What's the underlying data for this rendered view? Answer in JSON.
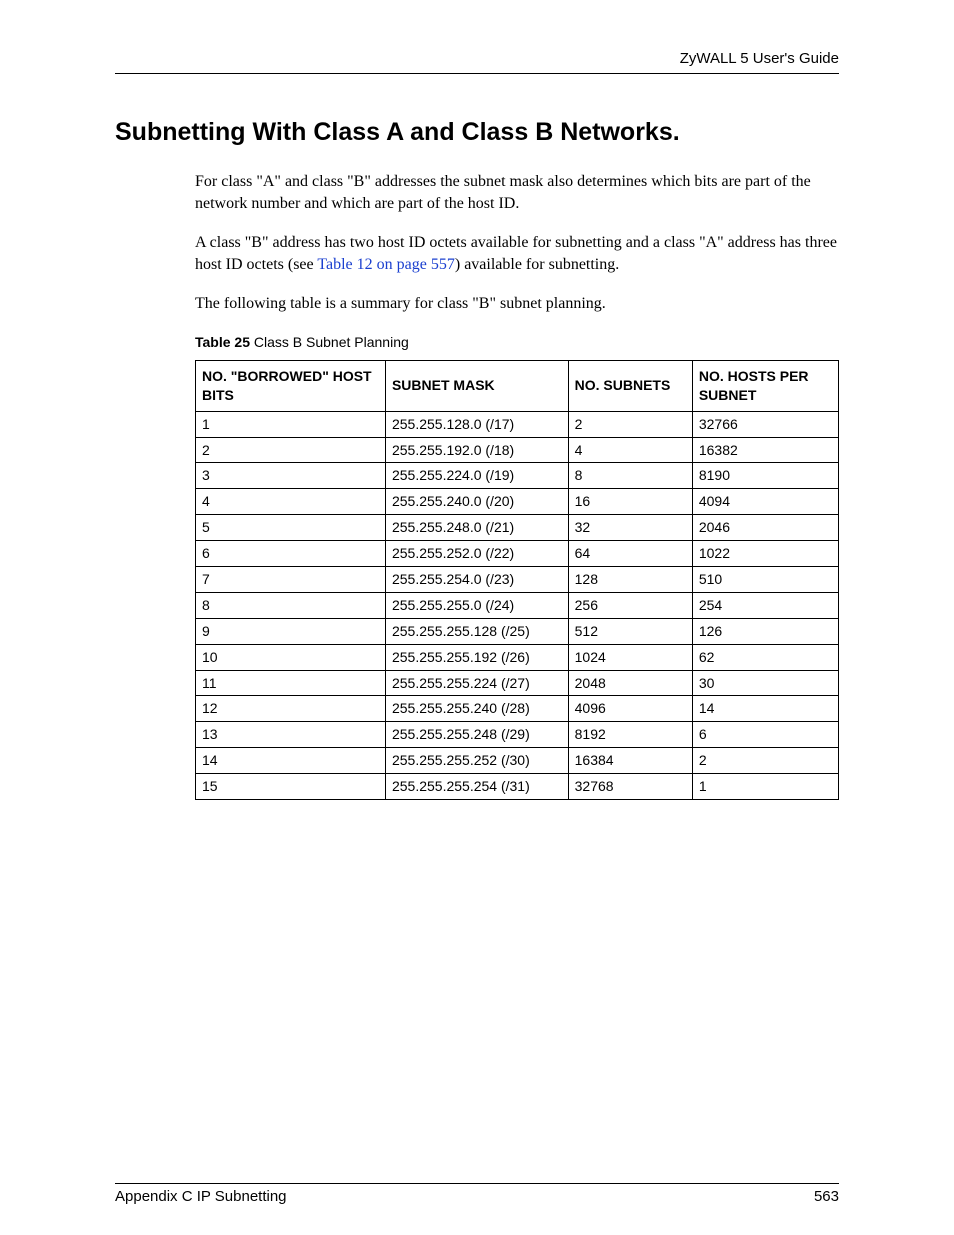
{
  "header": {
    "guide": "ZyWALL 5 User's Guide"
  },
  "section": {
    "title": "Subnetting With Class A and Class B Networks."
  },
  "paragraphs": {
    "p1": "For class \"A\" and class \"B\" addresses the subnet mask also determines which bits are part of the network number and which are part of the host ID.",
    "p2_pre": "A class \"B\" address has two host ID octets available for subnetting and a class \"A\" address has three host ID octets (see ",
    "p2_link": "Table 12 on page 557",
    "p2_post": ") available for subnetting.",
    "p3": "The following table is a summary for class \"B\" subnet planning."
  },
  "table": {
    "caption_label": "Table 25",
    "caption_text": "   Class B Subnet Planning",
    "headers": {
      "bits": "NO. \"BORROWED\" HOST BITS",
      "mask": "SUBNET MASK",
      "subnets": "NO. SUBNETS",
      "hosts": "NO. HOSTS PER SUBNET"
    },
    "rows": [
      {
        "bits": "1",
        "mask": "255.255.128.0 (/17)",
        "subnets": "2",
        "hosts": "32766"
      },
      {
        "bits": "2",
        "mask": "255.255.192.0 (/18)",
        "subnets": "4",
        "hosts": "16382"
      },
      {
        "bits": "3",
        "mask": "255.255.224.0 (/19)",
        "subnets": "8",
        "hosts": "8190"
      },
      {
        "bits": "4",
        "mask": "255.255.240.0 (/20)",
        "subnets": "16",
        "hosts": "4094"
      },
      {
        "bits": "5",
        "mask": "255.255.248.0 (/21)",
        "subnets": "32",
        "hosts": "2046"
      },
      {
        "bits": "6",
        "mask": "255.255.252.0 (/22)",
        "subnets": "64",
        "hosts": "1022"
      },
      {
        "bits": "7",
        "mask": "255.255.254.0 (/23)",
        "subnets": "128",
        "hosts": "510"
      },
      {
        "bits": "8",
        "mask": "255.255.255.0 (/24)",
        "subnets": "256",
        "hosts": "254"
      },
      {
        "bits": "9",
        "mask": "255.255.255.128 (/25)",
        "subnets": "512",
        "hosts": "126"
      },
      {
        "bits": "10",
        "mask": "255.255.255.192 (/26)",
        "subnets": "1024",
        "hosts": "62"
      },
      {
        "bits": "11",
        "mask": "255.255.255.224 (/27)",
        "subnets": "2048",
        "hosts": "30"
      },
      {
        "bits": "12",
        "mask": "255.255.255.240 (/28)",
        "subnets": "4096",
        "hosts": "14"
      },
      {
        "bits": "13",
        "mask": "255.255.255.248 (/29)",
        "subnets": "8192",
        "hosts": "6"
      },
      {
        "bits": "14",
        "mask": "255.255.255.252 (/30)",
        "subnets": "16384",
        "hosts": "2"
      },
      {
        "bits": "15",
        "mask": "255.255.255.254 (/31)",
        "subnets": "32768",
        "hosts": "1"
      }
    ]
  },
  "footer": {
    "left": "Appendix C IP Subnetting",
    "right": "563"
  }
}
